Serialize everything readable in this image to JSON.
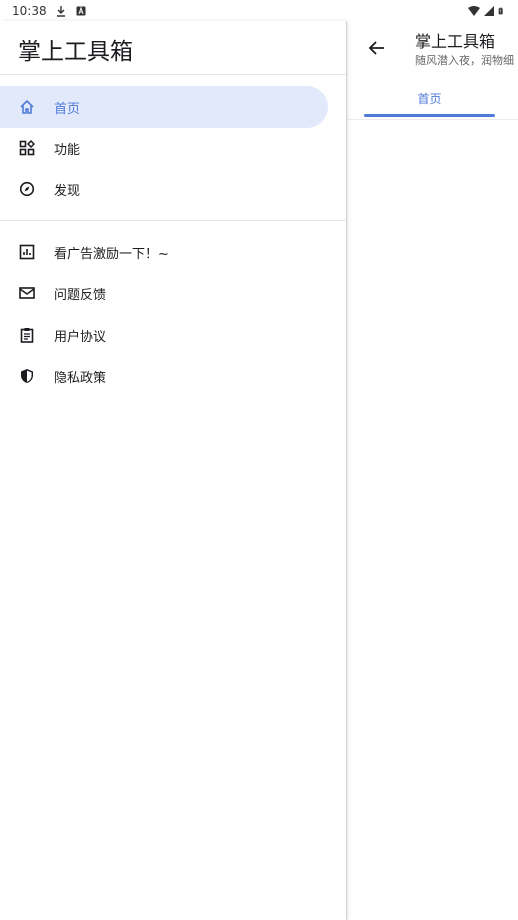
{
  "status_bar": {
    "time": "10:38",
    "left_icons": [
      "download-icon",
      "notification-a-icon"
    ],
    "right_icons": [
      "wifi-icon",
      "signal-icon",
      "battery-icon"
    ]
  },
  "app": {
    "title": "掌上工具箱",
    "subtitle": "随风潜入夜，润物细",
    "tabs": [
      {
        "label": "首页",
        "selected": true
      }
    ]
  },
  "drawer": {
    "header": "掌上工具箱",
    "primary_items": [
      {
        "label": "首页",
        "icon": "home-icon",
        "selected": true
      },
      {
        "label": "功能",
        "icon": "widgets-icon",
        "selected": false
      },
      {
        "label": "发现",
        "icon": "compass-icon",
        "selected": false
      }
    ],
    "secondary_items": [
      {
        "label": "看广告激励一下！~",
        "icon": "chart-icon"
      },
      {
        "label": "问题反馈",
        "icon": "mail-icon"
      },
      {
        "label": "用户协议",
        "icon": "clipboard-icon"
      },
      {
        "label": "隐私政策",
        "icon": "shield-icon"
      }
    ]
  },
  "colors": {
    "accent": "#4f7ad8",
    "active_bg": "#e1e9fb",
    "text": "#1c1b1f"
  }
}
